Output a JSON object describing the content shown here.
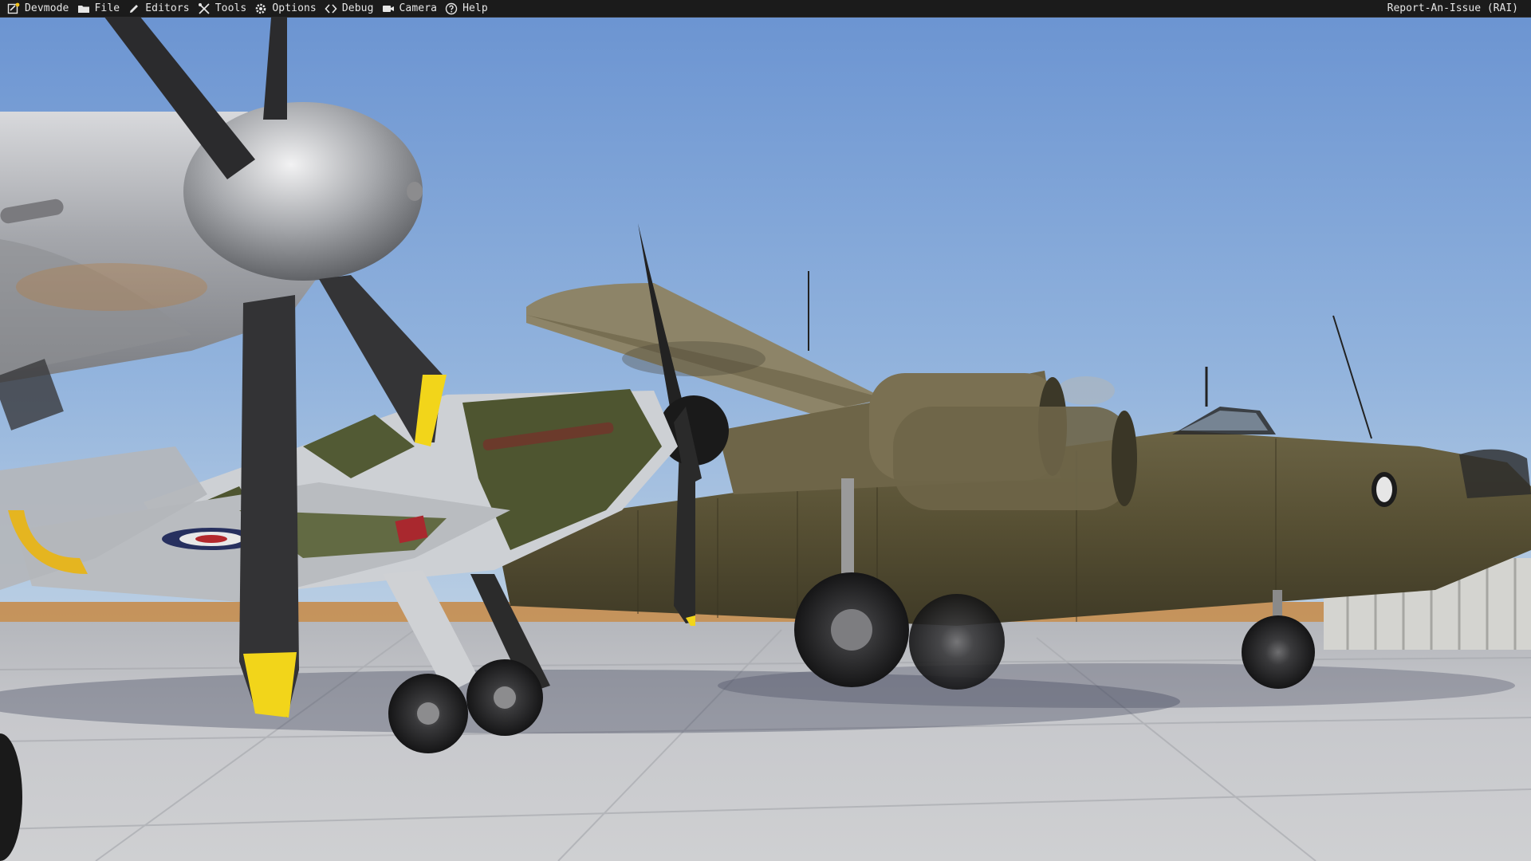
{
  "menubar": {
    "items": [
      {
        "label": "Devmode",
        "icon": "devmode-icon"
      },
      {
        "label": "File",
        "icon": "folder-icon"
      },
      {
        "label": "Editors",
        "icon": "pencil-icon"
      },
      {
        "label": "Tools",
        "icon": "tools-icon"
      },
      {
        "label": "Options",
        "icon": "gear-icon"
      },
      {
        "label": "Debug",
        "icon": "code-icon"
      },
      {
        "label": "Camera",
        "icon": "camera-icon"
      },
      {
        "label": "Help",
        "icon": "help-icon"
      }
    ],
    "right_link": "Report-An-Issue (RAI)"
  },
  "scene": {
    "description_colors": {
      "sky_top": "#6f97d2",
      "sky_bottom": "#b7cfe6",
      "tarmac": "#c4c6cb",
      "olive": "#5a5436",
      "silver": "#b9bcc1",
      "prop_tip_yellow": "#f2d51a"
    }
  }
}
